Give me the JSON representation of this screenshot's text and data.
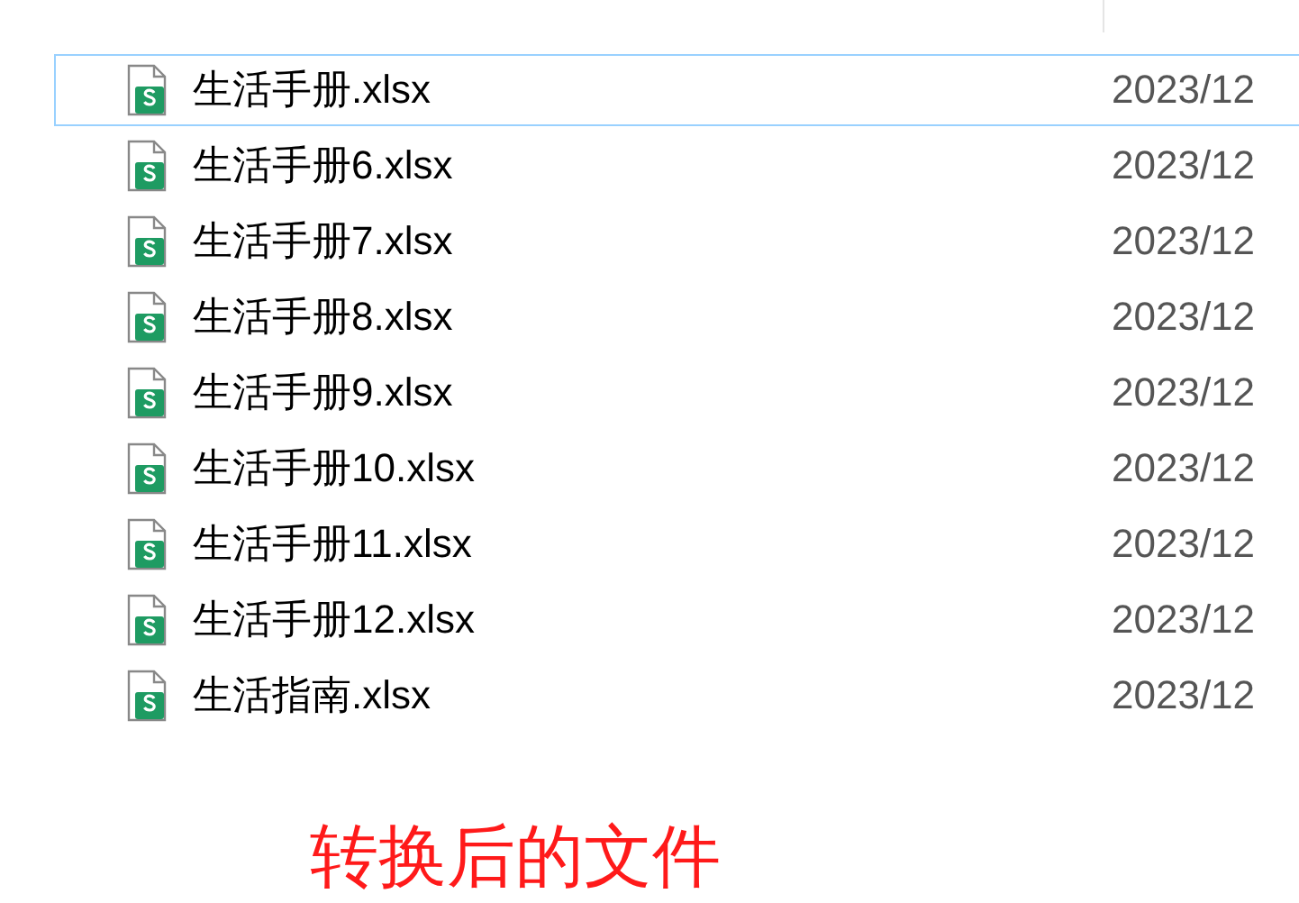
{
  "files": [
    {
      "name": "生活手册.xlsx",
      "date": "2023/12",
      "selected": true
    },
    {
      "name": "生活手册6.xlsx",
      "date": "2023/12",
      "selected": false
    },
    {
      "name": "生活手册7.xlsx",
      "date": "2023/12",
      "selected": false
    },
    {
      "name": "生活手册8.xlsx",
      "date": "2023/12",
      "selected": false
    },
    {
      "name": "生活手册9.xlsx",
      "date": "2023/12",
      "selected": false
    },
    {
      "name": "生活手册10.xlsx",
      "date": "2023/12",
      "selected": false
    },
    {
      "name": "生活手册11.xlsx",
      "date": "2023/12",
      "selected": false
    },
    {
      "name": "生活手册12.xlsx",
      "date": "2023/12",
      "selected": false
    },
    {
      "name": "生活指南.xlsx",
      "date": "2023/12",
      "selected": false
    }
  ],
  "caption": "转换后的文件"
}
